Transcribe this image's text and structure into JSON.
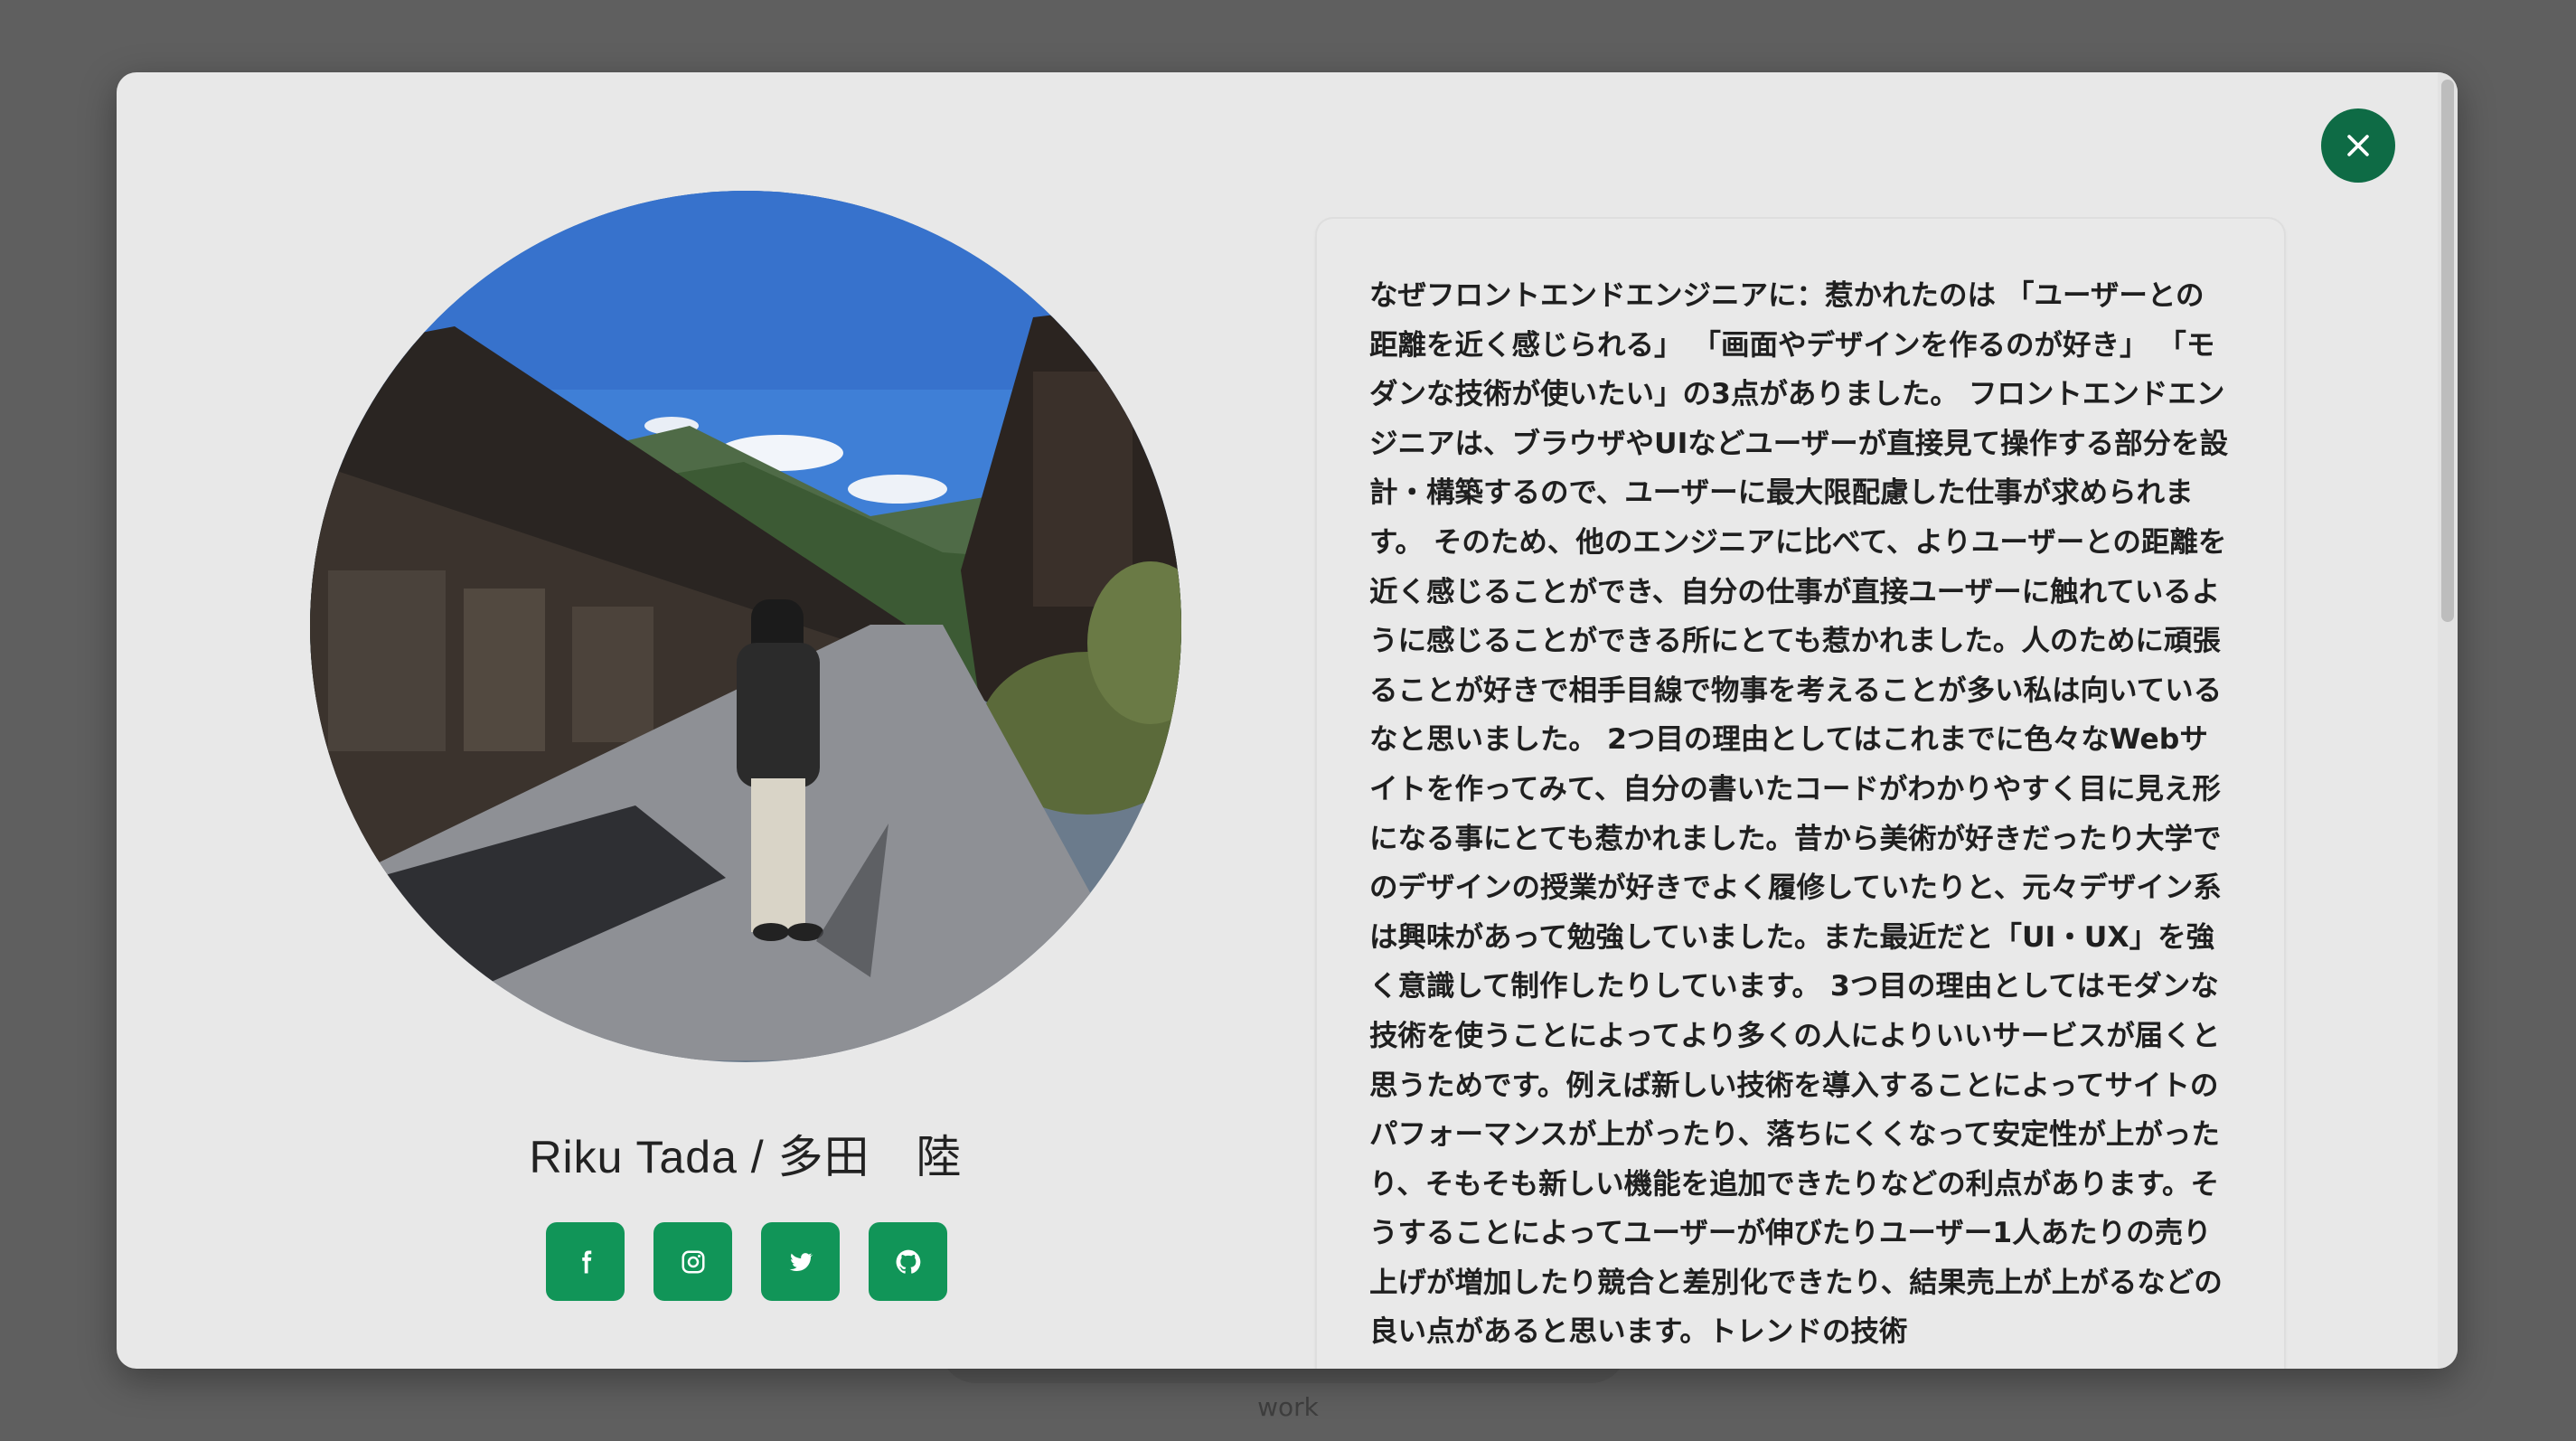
{
  "backdrop": {
    "label": "work"
  },
  "modal": {
    "close_icon": "close-icon",
    "profile": {
      "name": "Riku Tada / 多田　陸",
      "photo_icon": "profile-photo",
      "socials": [
        {
          "name": "facebook",
          "icon": "facebook-icon"
        },
        {
          "name": "instagram",
          "icon": "instagram-icon"
        },
        {
          "name": "twitter",
          "icon": "twitter-icon"
        },
        {
          "name": "github",
          "icon": "github-icon"
        }
      ]
    },
    "intro_text": "なぜフロントエンドエンジニアに：惹かれたのは 「ユーザーとの距離を近く感じられる」 「画面やデザインを作るのが好き」 「モダンな技術が使いたい」の3点がありました。 フロントエンドエンジニアは、ブラウザやUIなどユーザーが直接見て操作する部分を設計・構築するので、ユーザーに最大限配慮した仕事が求められます。 そのため、他のエンジニアに比べて、よりユーザーとの距離を近く感じることができ、自分の仕事が直接ユーザーに触れているように感じることができる所にとても惹かれました。人のために頑張ることが好きで相手目線で物事を考えることが多い私は向いているなと思いました。 2つ目の理由としてはこれまでに色々なWebサイトを作ってみて、自分の書いたコードがわかりやすく目に見え形になる事にとても惹かれました。昔から美術が好きだったり大学でのデザインの授業が好きでよく履修していたりと、元々デザイン系は興味があって勉強していました。また最近だと「UI・UX」を強く意識して制作したりしています。 3つ目の理由としてはモダンな技術を使うことによってより多くの人によりいいサービスが届くと思うためです。例えば新しい技術を導入することによってサイトのパフォーマンスが上がったり、落ちにくくなって安定性が上がったり、そもそも新しい機能を追加できたりなどの利点があります。そうすることによってユーザーが伸びたりユーザー1人あたりの売り上げが増加したり競合と差別化できたり、結果売上が上がるなどの良い点があると思います。トレンドの技術"
  },
  "colors": {
    "accent": "#0e6b45",
    "social_button": "#119558",
    "modal_bg": "#e8e8e8",
    "overlay": "#5f5f5f"
  }
}
